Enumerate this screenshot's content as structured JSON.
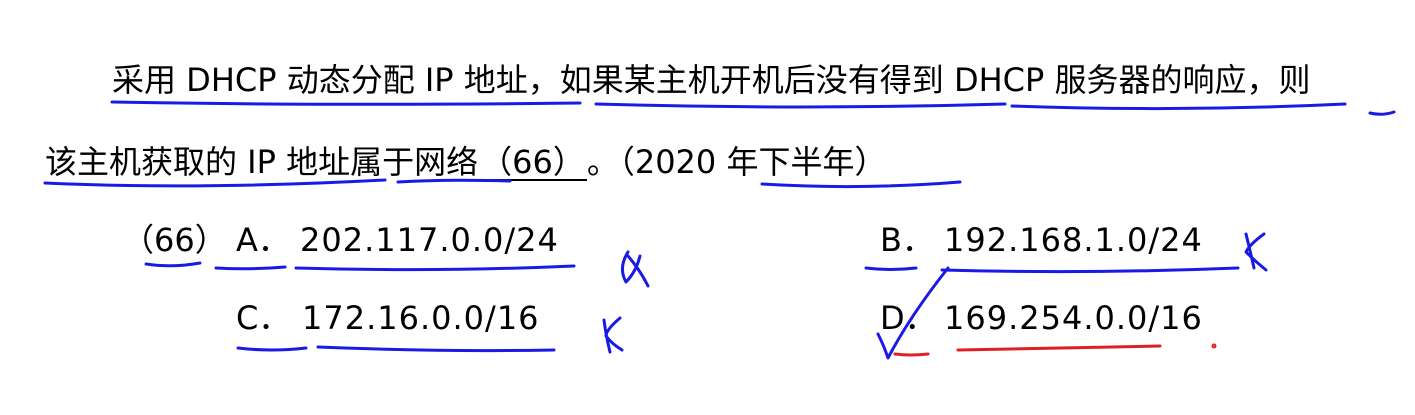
{
  "question": {
    "line1": "采用 DHCP 动态分配 IP 地址，如果某主机开机后没有得到 DHCP 服务器的响应，则",
    "line2_before": "该主机获取的 IP 地址属于网络",
    "blank_label": "（66）",
    "line2_after": "。（2020 年下半年）"
  },
  "options": {
    "number": "（66）",
    "a": {
      "letter": "A．",
      "text": "202.117.0.0/24"
    },
    "b": {
      "letter": "B．",
      "text": "192.168.1.0/24"
    },
    "c": {
      "letter": "C．",
      "text": "172.16.0.0/16"
    },
    "d": {
      "letter": "D．",
      "text": "169.254.0.0/16"
    }
  },
  "colors": {
    "blue_ink": "#1a1ae6",
    "red_ink": "#e02020"
  }
}
